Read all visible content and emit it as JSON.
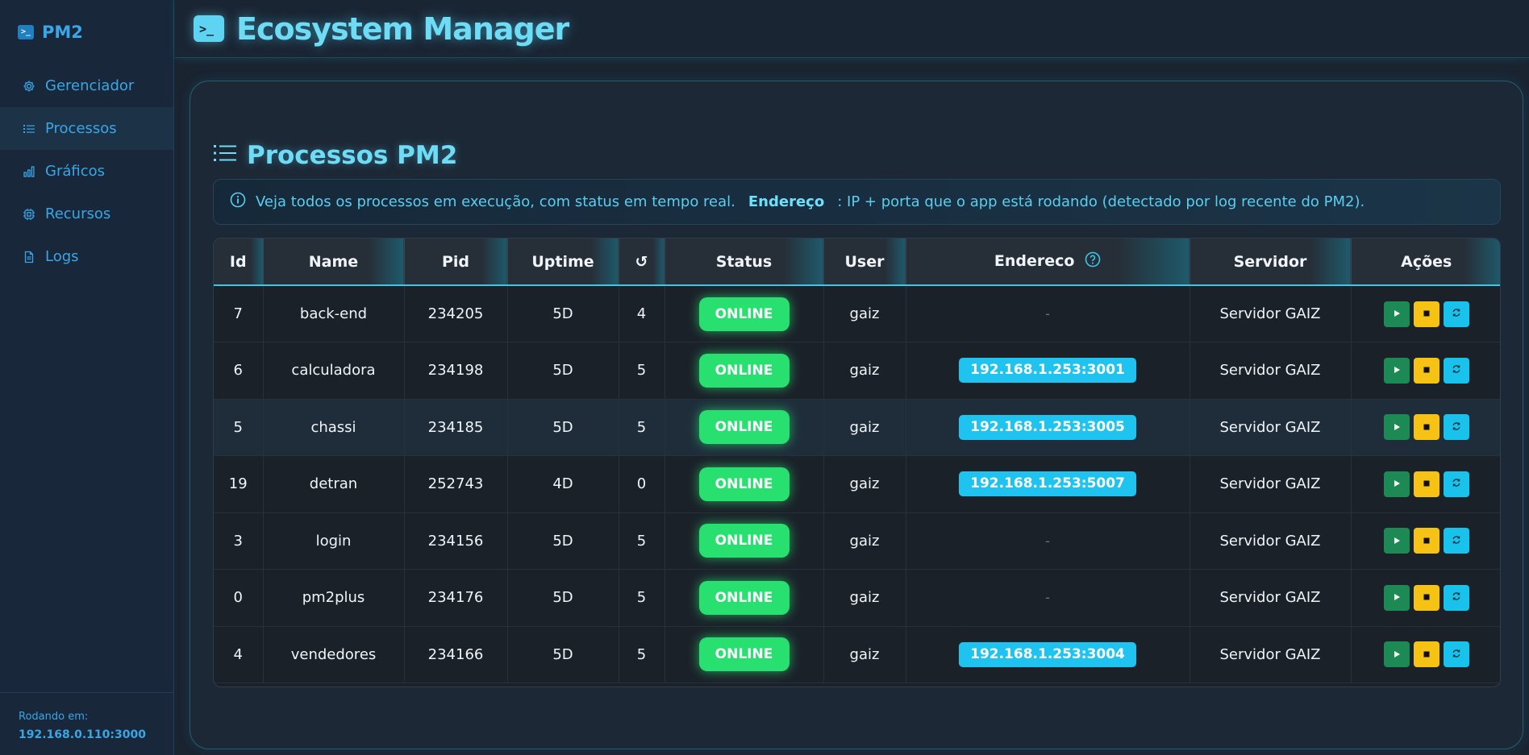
{
  "sidebar": {
    "brand": "PM2",
    "items": [
      {
        "label": "Gerenciador",
        "icon": "gear-icon"
      },
      {
        "label": "Processos",
        "icon": "list-icon",
        "active": true
      },
      {
        "label": "Gráficos",
        "icon": "bar-chart-icon"
      },
      {
        "label": "Recursos",
        "icon": "cpu-icon"
      },
      {
        "label": "Logs",
        "icon": "file-icon"
      }
    ],
    "footer_label": "Rodando em:",
    "footer_value": "192.168.0.110:3000"
  },
  "header": {
    "title": "Ecosystem Manager"
  },
  "main": {
    "section_title": "Processos PM2",
    "info_text": "Veja todos os processos em execução, com status em tempo real.",
    "info_strong": "Endereço",
    "info_rest": ": IP + porta que o app está rodando (detectado por log recente do PM2).",
    "columns": [
      "Id",
      "Name",
      "Pid",
      "Uptime",
      "↺",
      "Status",
      "User",
      "Endereco",
      "Servidor",
      "Ações"
    ],
    "rows": [
      {
        "id": "7",
        "name": "back-end",
        "pid": "234205",
        "uptime": "5D",
        "restarts": "4",
        "status": "ONLINE",
        "user": "gaiz",
        "address": "-",
        "server": "Servidor GAIZ"
      },
      {
        "id": "6",
        "name": "calculadora",
        "pid": "234198",
        "uptime": "5D",
        "restarts": "5",
        "status": "ONLINE",
        "user": "gaiz",
        "address": "192.168.1.253:3001",
        "server": "Servidor GAIZ"
      },
      {
        "id": "5",
        "name": "chassi",
        "pid": "234185",
        "uptime": "5D",
        "restarts": "5",
        "status": "ONLINE",
        "user": "gaiz",
        "address": "192.168.1.253:3005",
        "server": "Servidor GAIZ"
      },
      {
        "id": "19",
        "name": "detran",
        "pid": "252743",
        "uptime": "4D",
        "restarts": "0",
        "status": "ONLINE",
        "user": "gaiz",
        "address": "192.168.1.253:5007",
        "server": "Servidor GAIZ"
      },
      {
        "id": "3",
        "name": "login",
        "pid": "234156",
        "uptime": "5D",
        "restarts": "5",
        "status": "ONLINE",
        "user": "gaiz",
        "address": "-",
        "server": "Servidor GAIZ"
      },
      {
        "id": "0",
        "name": "pm2plus",
        "pid": "234176",
        "uptime": "5D",
        "restarts": "5",
        "status": "ONLINE",
        "user": "gaiz",
        "address": "-",
        "server": "Servidor GAIZ"
      },
      {
        "id": "4",
        "name": "vendedores",
        "pid": "234166",
        "uptime": "5D",
        "restarts": "5",
        "status": "ONLINE",
        "user": "gaiz",
        "address": "192.168.1.253:3004",
        "server": "Servidor GAIZ"
      }
    ]
  },
  "colors": {
    "accent": "#3aa6e6",
    "title": "#6fdcf6",
    "online": "#27e070",
    "address": "#1ec3f0",
    "play": "#1d8a55",
    "stop": "#f6c214",
    "restart": "#19c2ea"
  }
}
